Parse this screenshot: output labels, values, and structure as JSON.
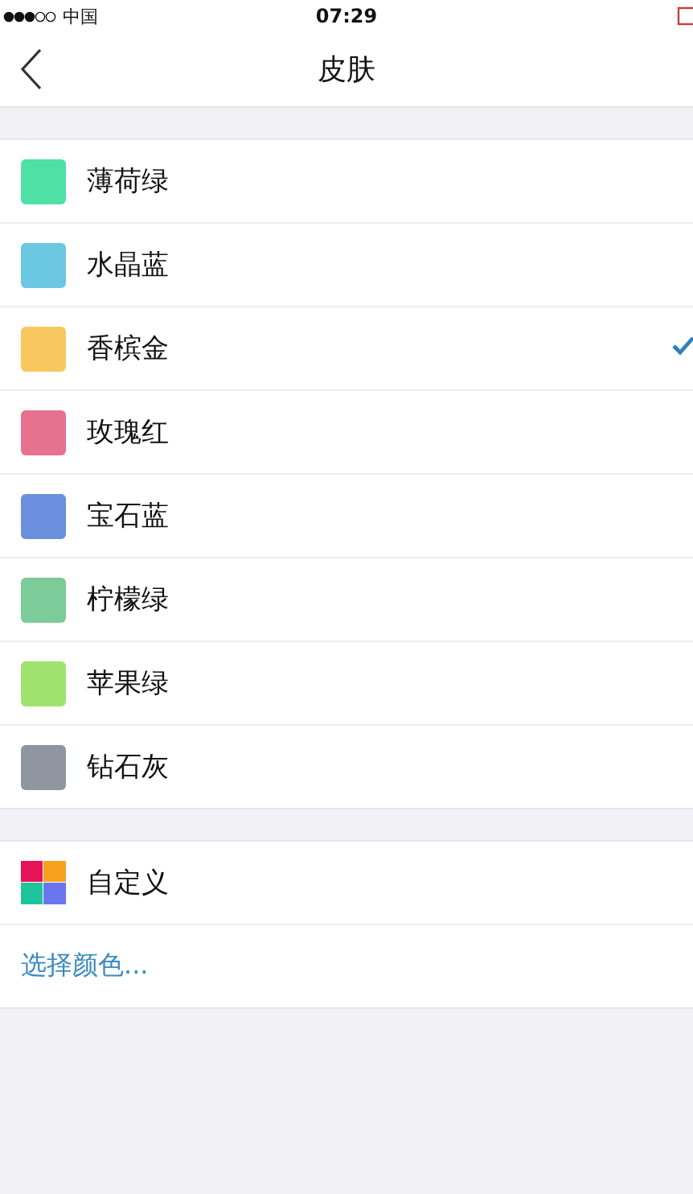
{
  "status_bar": {
    "carrier": "中国",
    "time": "07:29"
  },
  "nav": {
    "title": "皮肤"
  },
  "skins": [
    {
      "name": "薄荷绿",
      "color": "#4fe0a6",
      "selected": false
    },
    {
      "name": "水晶蓝",
      "color": "#6cc7e3",
      "selected": false
    },
    {
      "name": "香槟金",
      "color": "#f8c860",
      "selected": true
    },
    {
      "name": "玫瑰红",
      "color": "#e67290",
      "selected": false
    },
    {
      "name": "宝石蓝",
      "color": "#6a8fdc",
      "selected": false
    },
    {
      "name": "柠檬绿",
      "color": "#7ccb98",
      "selected": false
    },
    {
      "name": "苹果绿",
      "color": "#a0e26e",
      "selected": false
    },
    {
      "name": "钻石灰",
      "color": "#8f969f",
      "selected": false
    }
  ],
  "custom": {
    "label": "自定义",
    "link": "选择颜色..."
  }
}
